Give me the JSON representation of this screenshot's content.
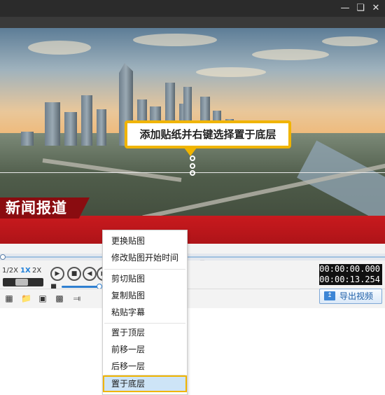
{
  "window": {
    "minimize_icon": "minimize-icon",
    "maximize_icon": "restore-icon",
    "close_icon": "close-icon"
  },
  "preview": {
    "callout_text": "添加贴纸并右键选择置于底层",
    "news_title": "新闻报道"
  },
  "playback": {
    "speeds": [
      "1/2X",
      "1X",
      "2X"
    ],
    "active_speed": "1X",
    "current_time": "00:00:00.000",
    "total_time": "00:00:13.254",
    "export_label": "导出视频",
    "buttons": [
      "play-icon",
      "stop-icon",
      "prev-frame-icon",
      "next-frame-icon"
    ]
  },
  "toolbar": {
    "icons": [
      "new-project-icon",
      "open-folder-icon",
      "save-icon",
      "save-as-icon",
      "share-icon"
    ]
  },
  "context_menu": {
    "items": [
      "更换贴图",
      "修改贴图开始时间",
      "剪切贴图",
      "复制贴图",
      "粘贴字幕",
      "置于顶层",
      "前移一层",
      "后移一层",
      "置于底层"
    ],
    "highlighted": "置于底层"
  },
  "colors": {
    "title_bar": "#2b2b2b",
    "news_red": "#c91a1e",
    "callout_border": "#f0b400",
    "accent_blue": "#1f7fd8",
    "menu_highlight": "#cde4f7"
  }
}
